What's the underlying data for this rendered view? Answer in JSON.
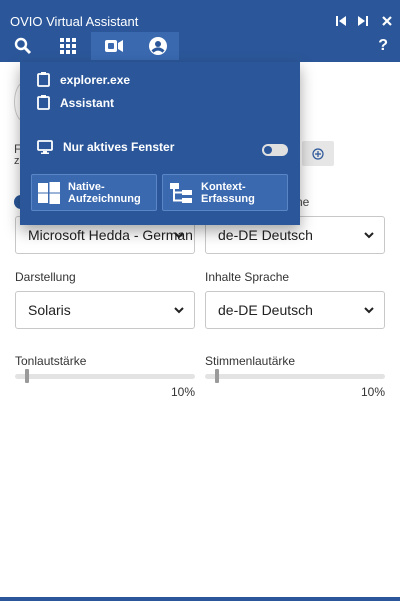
{
  "window": {
    "title": "OVIO Virtual Assistant",
    "controls": [
      "skip-back-icon",
      "skip-forward-icon",
      "close-icon"
    ],
    "help_label": "?"
  },
  "toolbar": {
    "icons": [
      "search-icon",
      "grid-icon",
      "video-camera-icon",
      "user-circle-icon"
    ],
    "active": "video-camera-icon"
  },
  "overlay": {
    "items": [
      {
        "label": "explorer.exe",
        "icon": "clipboard-icon"
      },
      {
        "label": "Assistant",
        "icon": "clipboard-icon"
      }
    ],
    "active_window_label": "Nur aktives Fenster",
    "active_window_toggle": false,
    "native_button_label": "Native-\nAufzeichnung",
    "context_button_label": "Kontext-\nErfassung"
  },
  "settings": {
    "peek_letter_1": "F",
    "peek_letter_2": "z",
    "peek_ne": "ne",
    "voice_select": "Microsoft Hedda - German (Germany)",
    "voice_language_select": "de-DE Deutsch",
    "display_label": "Darstellung",
    "display_select": "Solaris",
    "content_language_label": "Inhalte Sprache",
    "content_language_select": "de-DE Deutsch",
    "tone_volume_label": "Tonlautstärke",
    "tone_volume_value": "10%",
    "tone_volume_fraction": 0.1,
    "voice_volume_label": "Stimmenlautärke",
    "voice_volume_value": "10%",
    "voice_volume_fraction": 0.1
  },
  "colors": {
    "accent": "#2b579a",
    "accent_light": "#3a69b0"
  }
}
